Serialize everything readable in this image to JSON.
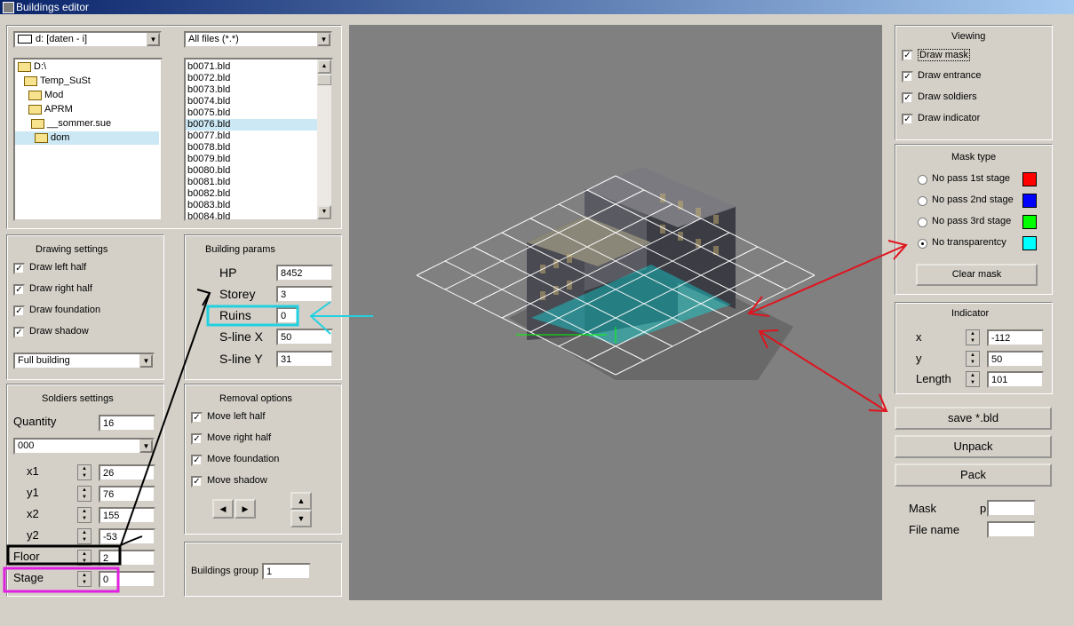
{
  "window": {
    "title": "Buildings editor"
  },
  "file_browser": {
    "drive": "d: [daten - i]",
    "filter": "All files (*.*)",
    "folders": [
      "D:\\",
      "Temp_SuSt",
      "Mod",
      "APRM",
      "__sommer.sue",
      "dom"
    ],
    "files": [
      "b0071.bld",
      "b0072.bld",
      "b0073.bld",
      "b0074.bld",
      "b0075.bld",
      "b0076.bld",
      "b0077.bld",
      "b0078.bld",
      "b0079.bld",
      "b0080.bld",
      "b0081.bld",
      "b0082.bld",
      "b0083.bld",
      "b0084.bld"
    ],
    "selected_file": "b0076.bld"
  },
  "drawing_settings": {
    "title": "Drawing settings",
    "options": [
      {
        "label": "Draw left half",
        "checked": true
      },
      {
        "label": "Draw right half",
        "checked": true
      },
      {
        "label": "Draw foundation",
        "checked": true
      },
      {
        "label": "Draw shadow",
        "checked": true
      }
    ],
    "mode": "Full building"
  },
  "building_params": {
    "title": "Building params",
    "fields": [
      {
        "label": "HP",
        "value": "8452"
      },
      {
        "label": "Storey",
        "value": "3"
      },
      {
        "label": "Ruins",
        "value": "0"
      },
      {
        "label": "S-line X",
        "value": "50"
      },
      {
        "label": "S-line Y",
        "value": "31"
      }
    ]
  },
  "soldiers_settings": {
    "title": "Soldiers settings",
    "quantity_label": "Quantity",
    "quantity": "16",
    "selected": "000",
    "fields": [
      {
        "label": "x1",
        "value": "26"
      },
      {
        "label": "y1",
        "value": "76"
      },
      {
        "label": "x2",
        "value": "155"
      },
      {
        "label": "y2",
        "value": "-53"
      },
      {
        "label": "Floor",
        "value": "2"
      },
      {
        "label": "Stage",
        "value": "0"
      }
    ]
  },
  "removal_options": {
    "title": "Removal options",
    "options": [
      {
        "label": "Move left half",
        "checked": true
      },
      {
        "label": "Move right half",
        "checked": true
      },
      {
        "label": "Move foundation",
        "checked": true
      },
      {
        "label": "Move shadow",
        "checked": true
      }
    ]
  },
  "buildings_group": {
    "label": "Buildings group",
    "value": "1"
  },
  "viewing": {
    "title": "Viewing",
    "options": [
      {
        "label": "Draw mask",
        "checked": true
      },
      {
        "label": "Draw entrance",
        "checked": true
      },
      {
        "label": "Draw soldiers",
        "checked": true
      },
      {
        "label": "Draw indicator",
        "checked": true
      }
    ]
  },
  "mask_type": {
    "title": "Mask type",
    "options": [
      {
        "label": "No pass 1st stage",
        "color": "#ff0000",
        "selected": false
      },
      {
        "label": "No pass 2nd stage",
        "color": "#0000ff",
        "selected": false
      },
      {
        "label": "No pass 3rd stage",
        "color": "#00ff00",
        "selected": false
      },
      {
        "label": "No transparentcy",
        "color": "#00ffff",
        "selected": true
      }
    ],
    "clear_label": "Clear mask"
  },
  "indicator": {
    "title": "Indicator",
    "fields": [
      {
        "label": "x",
        "value": "-112"
      },
      {
        "label": "y",
        "value": "50"
      },
      {
        "label": "Length",
        "value": "101"
      }
    ]
  },
  "actions": {
    "save": "save *.bld",
    "unpack": "Unpack",
    "pack": "Pack"
  },
  "bottom_fields": {
    "mask_label": "Mask",
    "mask_value": "p",
    "filename_label": "File name",
    "filename_value": ""
  },
  "annotation_colors": {
    "red": "#e0141e",
    "cyan": "#22d0e0",
    "black": "#000000",
    "magenta": "#e020e0"
  }
}
